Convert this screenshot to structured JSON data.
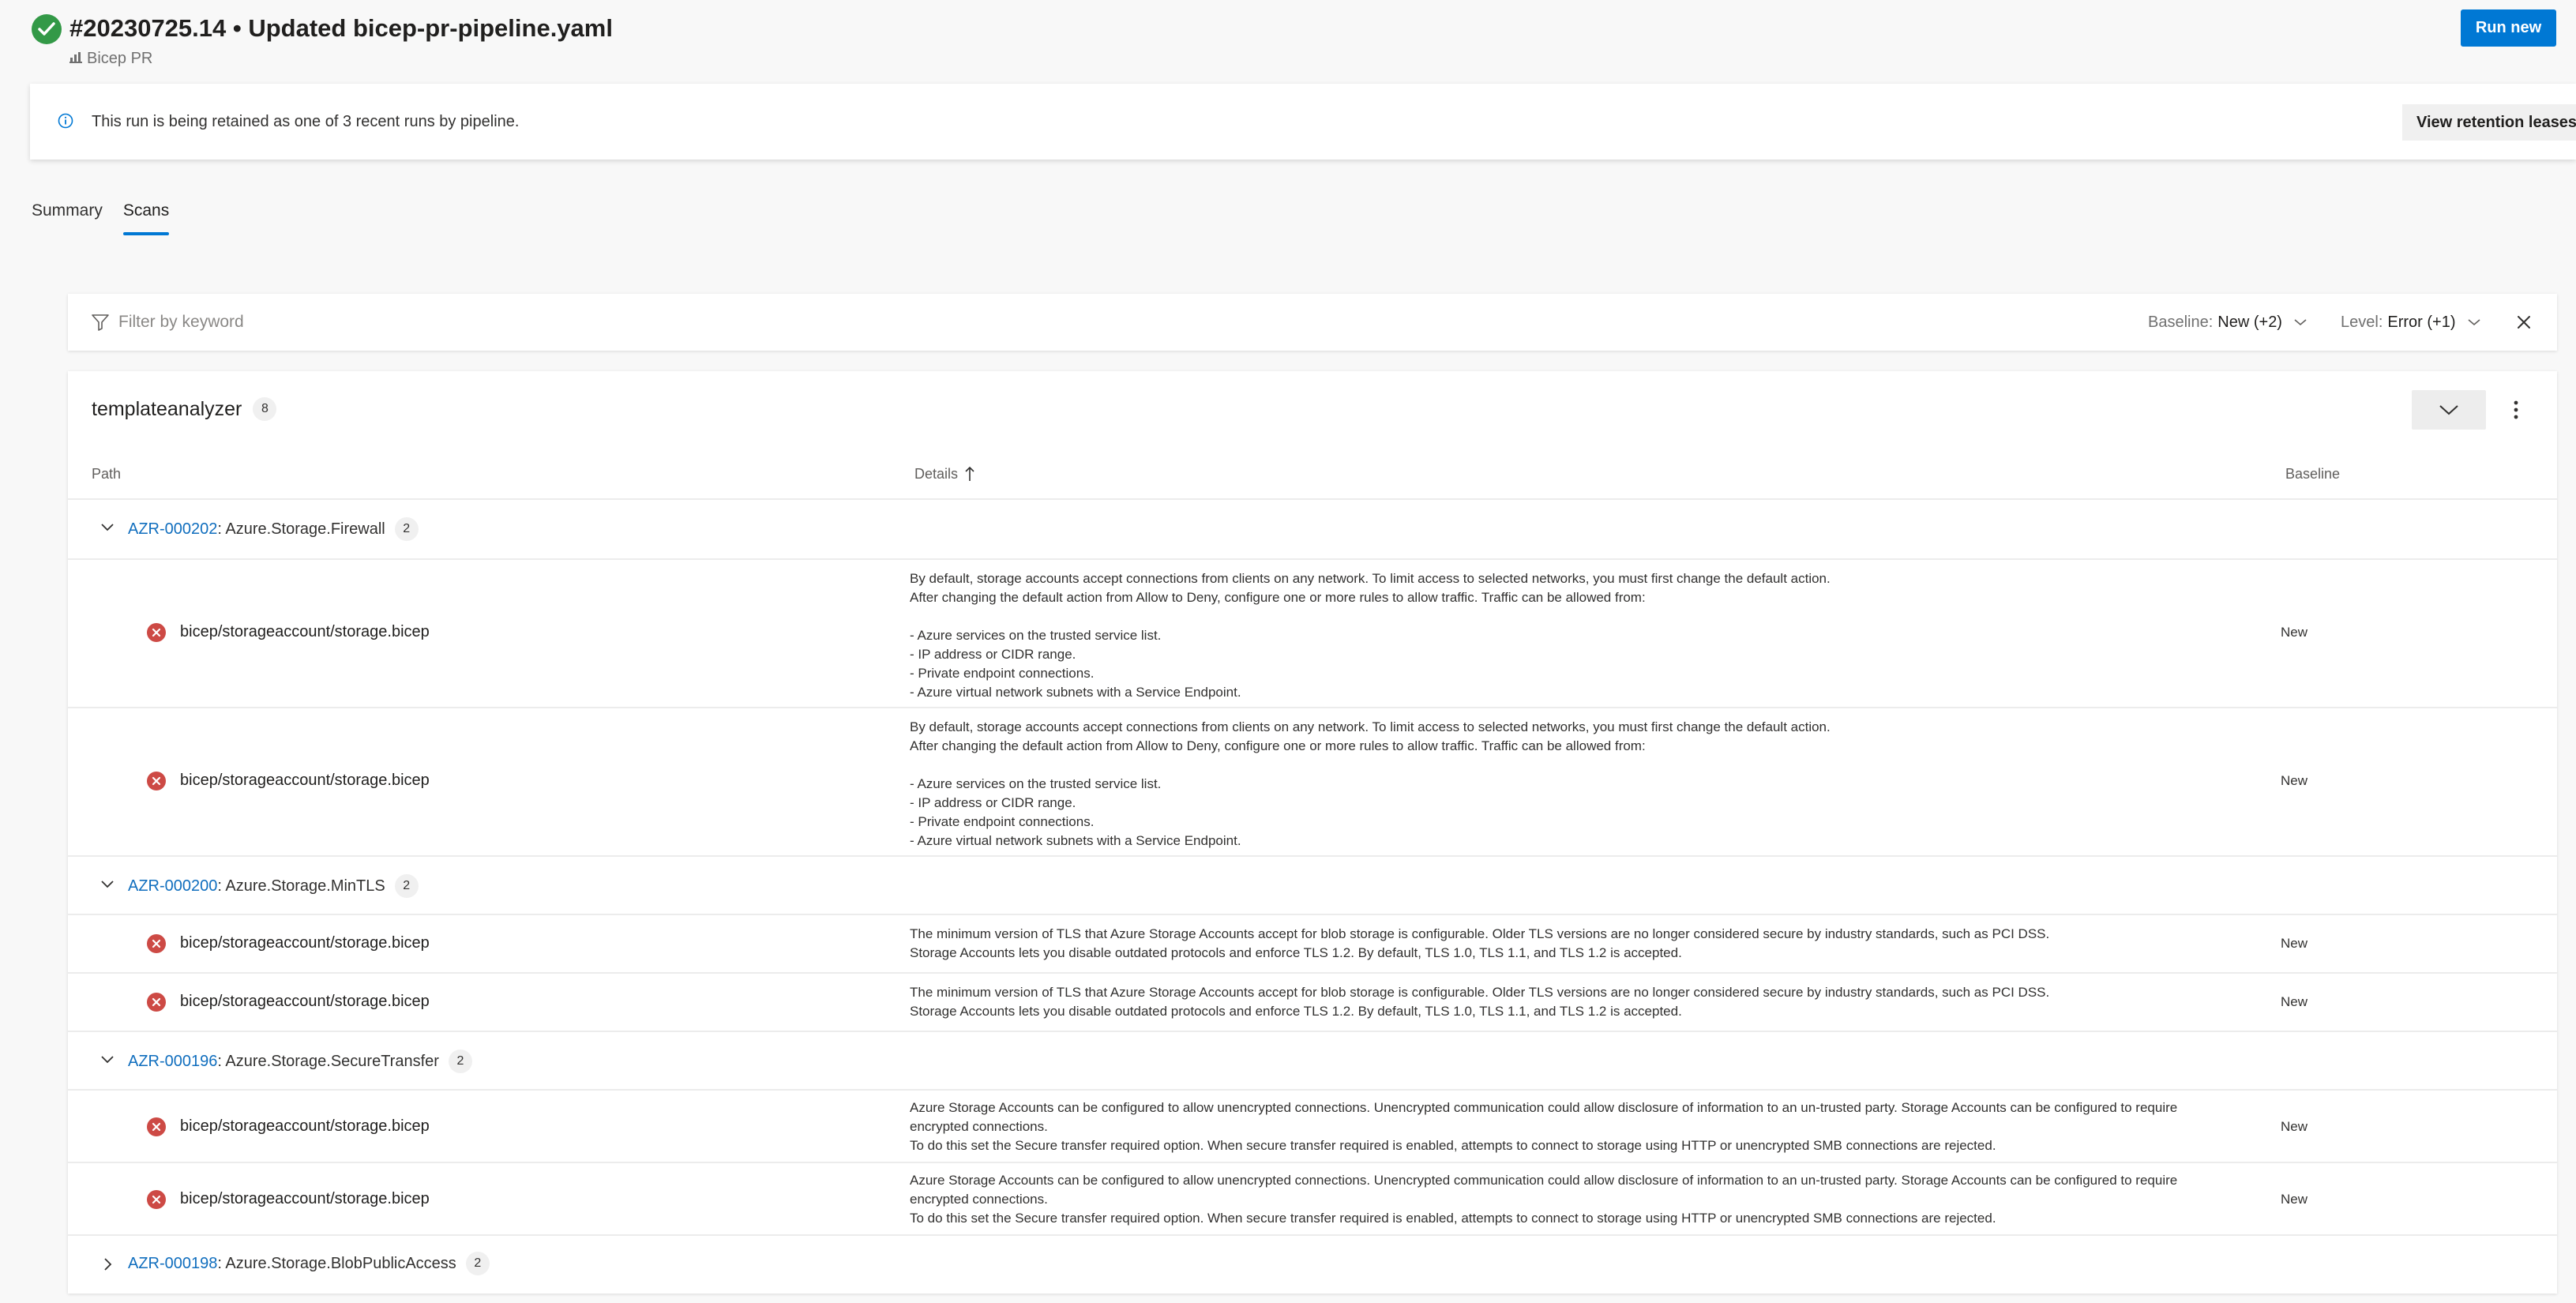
{
  "header": {
    "run_title": "#20230725.14 • Updated bicep-pr-pipeline.yaml",
    "pipeline_name": "Bicep PR",
    "run_new_label": "Run new"
  },
  "banner": {
    "message": "This run is being retained as one of 3 recent runs by pipeline.",
    "retention_button": "View retention leases"
  },
  "tabs": [
    {
      "label": "Summary",
      "active": false
    },
    {
      "label": "Scans",
      "active": true
    }
  ],
  "filter": {
    "placeholder": "Filter by keyword",
    "baseline_label": "Baseline:",
    "baseline_value": "New (+2)",
    "level_label": "Level:",
    "level_value": "Error (+1)"
  },
  "results": {
    "tool_name": "templateanalyzer",
    "count": "8",
    "columns": {
      "path": "Path",
      "details": "Details",
      "baseline": "Baseline"
    },
    "groups": [
      {
        "id": "AZR-000202",
        "name": ": Azure.Storage.Firewall",
        "count": "2",
        "expanded": true
      },
      {
        "id": "AZR-000200",
        "name": ": Azure.Storage.MinTLS",
        "count": "2",
        "expanded": true
      },
      {
        "id": "AZR-000196",
        "name": ": Azure.Storage.SecureTransfer",
        "count": "2",
        "expanded": true
      },
      {
        "id": "AZR-000198",
        "name": ": Azure.Storage.BlobPublicAccess",
        "count": "2",
        "expanded": false
      }
    ],
    "rows": [
      {
        "path": "bicep/storageaccount/storage.bicep",
        "baseline": "New",
        "details": "By default, storage accounts accept connections from clients on any network. To limit access to selected networks, you must first change the default action.\nAfter changing the default action from Allow to Deny, configure one or more rules to allow traffic. Traffic can be allowed from:\n\n- Azure services on the trusted service list.\n- IP address or CIDR range.\n- Private endpoint connections.\n- Azure virtual network subnets with a Service Endpoint."
      },
      {
        "path": "bicep/storageaccount/storage.bicep",
        "baseline": "New",
        "details": "By default, storage accounts accept connections from clients on any network. To limit access to selected networks, you must first change the default action.\nAfter changing the default action from Allow to Deny, configure one or more rules to allow traffic. Traffic can be allowed from:\n\n- Azure services on the trusted service list.\n- IP address or CIDR range.\n- Private endpoint connections.\n- Azure virtual network subnets with a Service Endpoint."
      },
      {
        "path": "bicep/storageaccount/storage.bicep",
        "baseline": "New",
        "details": "The minimum version of TLS that Azure Storage Accounts accept for blob storage is configurable. Older TLS versions are no longer considered secure by industry standards, such as PCI DSS.\nStorage Accounts lets you disable outdated protocols and enforce TLS 1.2. By default, TLS 1.0, TLS 1.1, and TLS 1.2 is accepted."
      },
      {
        "path": "bicep/storageaccount/storage.bicep",
        "baseline": "New",
        "details": "The minimum version of TLS that Azure Storage Accounts accept for blob storage is configurable. Older TLS versions are no longer considered secure by industry standards, such as PCI DSS.\nStorage Accounts lets you disable outdated protocols and enforce TLS 1.2. By default, TLS 1.0, TLS 1.1, and TLS 1.2 is accepted."
      },
      {
        "path": "bicep/storageaccount/storage.bicep",
        "baseline": "New",
        "details": "Azure Storage Accounts can be configured to allow unencrypted connections. Unencrypted communication could allow disclosure of information to an un-trusted party. Storage Accounts can be configured to require\nencrypted connections.\nTo do this set the Secure transfer required option. When secure transfer required is enabled, attempts to connect to storage using HTTP or unencrypted SMB connections are rejected."
      },
      {
        "path": "bicep/storageaccount/storage.bicep",
        "baseline": "New",
        "details": "Azure Storage Accounts can be configured to allow unencrypted connections. Unencrypted communication could allow disclosure of information to an un-trusted party. Storage Accounts can be configured to require\nencrypted connections.\nTo do this set the Secure transfer required option. When secure transfer required is enabled, attempts to connect to storage using HTTP or unencrypted SMB connections are rejected."
      }
    ]
  },
  "colors": {
    "accent": "#0078d4",
    "success": "#339947",
    "error": "#cd4a45",
    "link": "#106ebe"
  },
  "icons": {
    "status": "check-circle-icon",
    "pipeline": "pipeline-icon",
    "info": "info-icon",
    "filter": "filter-icon",
    "error": "error-circle-icon"
  }
}
